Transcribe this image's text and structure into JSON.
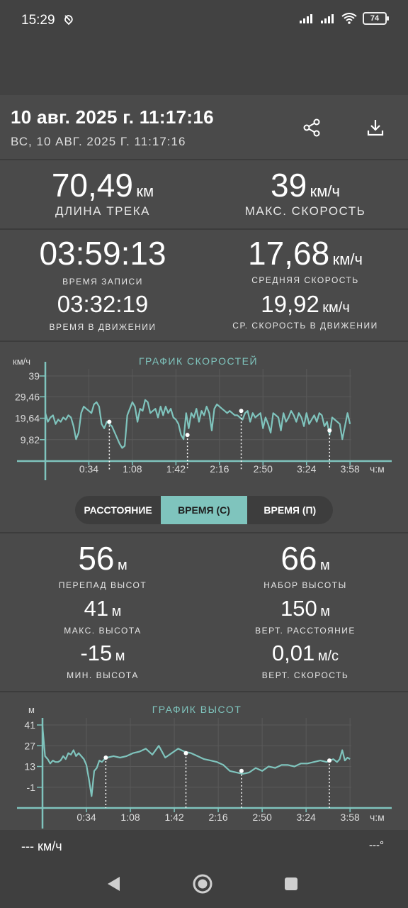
{
  "status": {
    "time": "15:29",
    "battery": "74"
  },
  "header": {
    "title": "10 авг. 2025 г. 11:17:16",
    "subtitle": "ВС, 10 АВГ. 2025 Г. 11:17:16",
    "share_icon": "share-icon",
    "download_icon": "download-icon"
  },
  "stats": {
    "track_length": {
      "value": "70,49",
      "unit": "км",
      "label": "ДЛИНА ТРЕКА"
    },
    "max_speed": {
      "value": "39",
      "unit": "км/ч",
      "label": "МАКС. СКОРОСТЬ"
    },
    "record_time": {
      "value": "03:59:13",
      "label": "ВРЕМЯ ЗАПИСИ"
    },
    "avg_speed": {
      "value": "17,68",
      "unit": "км/ч",
      "label": "СРЕДНЯЯ СКОРОСТЬ"
    },
    "moving_time": {
      "value": "03:32:19",
      "label": "ВРЕМЯ В ДВИЖЕНИИ"
    },
    "avg_moving_speed": {
      "value": "19,92",
      "unit": "км/ч",
      "label": "СР. СКОРОСТЬ В ДВИЖЕНИИ"
    }
  },
  "tabs": {
    "distance": "РАССТОЯНИЕ",
    "time_c": "ВРЕМЯ (С)",
    "time_p": "ВРЕМЯ (П)",
    "active": "time_c"
  },
  "elevation": {
    "elev_diff": {
      "value": "56",
      "unit": "м",
      "label": "ПЕРЕПАД ВЫСОТ"
    },
    "elev_gain": {
      "value": "66",
      "unit": "м",
      "label": "НАБОР ВЫСОТЫ"
    },
    "max_elev": {
      "value": "41",
      "unit": "м",
      "label": "МАКС. ВЫСОТА"
    },
    "vert_dist": {
      "value": "150",
      "unit": "м",
      "label": "ВЕРТ. РАССТОЯНИЕ"
    },
    "min_elev": {
      "value": "-15",
      "unit": "м",
      "label": "МИН. ВЫСОТА"
    },
    "vert_speed": {
      "value": "0,01",
      "unit": "м/с",
      "label": "ВЕРТ. СКОРОСТЬ"
    }
  },
  "footer": {
    "speed": "--- км/ч",
    "heading": "---°"
  },
  "colors": {
    "accent": "#7fc4bd",
    "background": "#4a4a4a"
  },
  "chart_data": [
    {
      "type": "line",
      "title": "ГРАФИК СКОРОСТЕЙ",
      "ylabel": "км/ч",
      "xlabel": "ч:м",
      "yticks": [
        "39",
        "29,46",
        "19,64",
        "9,82"
      ],
      "yticks_num": [
        39,
        29.46,
        19.64,
        9.82
      ],
      "xticks": [
        "0:34",
        "1:08",
        "1:42",
        "2:16",
        "2:50",
        "3:24",
        "3:58"
      ],
      "xticks_num": [
        34,
        68,
        102,
        136,
        170,
        204,
        238
      ],
      "ylim": [
        0,
        39
      ],
      "xlim": [
        0,
        239
      ],
      "grid": true,
      "x": [
        0,
        2,
        4,
        6,
        8,
        10,
        12,
        14,
        16,
        18,
        20,
        22,
        24,
        26,
        28,
        30,
        32,
        34,
        36,
        38,
        40,
        42,
        44,
        46,
        48,
        50,
        52,
        55,
        58,
        60,
        62,
        64,
        66,
        68,
        70,
        72,
        74,
        76,
        78,
        80,
        82,
        84,
        86,
        88,
        90,
        92,
        94,
        96,
        98,
        100,
        102,
        104,
        106,
        108,
        110,
        112,
        114,
        116,
        118,
        120,
        122,
        124,
        126,
        128,
        130,
        132,
        134,
        136,
        138,
        140,
        142,
        144,
        146,
        148,
        150,
        152,
        154,
        156,
        158,
        160,
        162,
        164,
        166,
        168,
        170,
        172,
        174,
        176,
        178,
        180,
        182,
        184,
        186,
        188,
        190,
        192,
        194,
        196,
        198,
        200,
        202,
        204,
        206,
        208,
        210,
        212,
        214,
        216,
        218,
        220,
        222,
        224,
        226,
        228,
        230,
        232,
        234,
        236,
        238
      ],
      "values": [
        22,
        18,
        20,
        21,
        17,
        19,
        18,
        20,
        19,
        21,
        20,
        16,
        10,
        13,
        22,
        25,
        24,
        23,
        22,
        26,
        27,
        25,
        17,
        15,
        18,
        17,
        16,
        12,
        8,
        6,
        7,
        21,
        24,
        27,
        25,
        18,
        24,
        23,
        28,
        27,
        22,
        23,
        24,
        20,
        25,
        21,
        25,
        22,
        24,
        20,
        19,
        17,
        12,
        10,
        22,
        15,
        22,
        20,
        24,
        18,
        23,
        21,
        25,
        22,
        14,
        24,
        26,
        25,
        24,
        23,
        22,
        23,
        22,
        21,
        21,
        20,
        19,
        22,
        23,
        18,
        22,
        20,
        21,
        22,
        15,
        20,
        17,
        13,
        22,
        21,
        20,
        14,
        22,
        18,
        20,
        23,
        21,
        18,
        22,
        20,
        16,
        22,
        17,
        19,
        21,
        18,
        22,
        21,
        16,
        18,
        12,
        20,
        19,
        18,
        17,
        10,
        16,
        22,
        17
      ],
      "markers_x": [
        50,
        111,
        153,
        222
      ],
      "markers_y": [
        18,
        12,
        23,
        14
      ]
    },
    {
      "type": "line",
      "title": "ГРАФИК ВЫСОТ",
      "ylabel": "м",
      "xlabel": "ч:м",
      "yticks": [
        "41",
        "27",
        "13",
        "-1"
      ],
      "yticks_num": [
        41,
        27,
        13,
        -1
      ],
      "xticks": [
        "0:34",
        "1:08",
        "1:42",
        "2:16",
        "2:50",
        "3:24",
        "3:58"
      ],
      "xticks_num": [
        34,
        68,
        102,
        136,
        170,
        204,
        238
      ],
      "ylim": [
        -15,
        41
      ],
      "xlim": [
        0,
        239
      ],
      "grid": true,
      "x": [
        0,
        2,
        4,
        6,
        8,
        10,
        12,
        14,
        16,
        18,
        20,
        22,
        24,
        26,
        28,
        30,
        32,
        34,
        36,
        38,
        40,
        42,
        44,
        46,
        48,
        50,
        55,
        60,
        65,
        70,
        75,
        80,
        85,
        90,
        95,
        100,
        105,
        110,
        115,
        120,
        125,
        130,
        135,
        140,
        145,
        150,
        155,
        160,
        165,
        170,
        175,
        180,
        185,
        190,
        195,
        200,
        205,
        210,
        215,
        220,
        225,
        228,
        230,
        232,
        234,
        236,
        238
      ],
      "values": [
        40,
        20,
        18,
        15,
        17,
        16,
        16,
        17,
        20,
        18,
        22,
        21,
        24,
        20,
        22,
        20,
        18,
        14,
        4,
        -7,
        10,
        12,
        17,
        16,
        18,
        19,
        20,
        19,
        20,
        22,
        23,
        25,
        21,
        27,
        19,
        22,
        25,
        23,
        22,
        20,
        18,
        17,
        16,
        14,
        10,
        9,
        8,
        9,
        12,
        10,
        13,
        12,
        14,
        14,
        13,
        15,
        15,
        16,
        17,
        16,
        18,
        16,
        18,
        24,
        17,
        19,
        18
      ],
      "markers_x": [
        49,
        111,
        154,
        222
      ],
      "markers_y": [
        19,
        22,
        10,
        17
      ]
    }
  ]
}
